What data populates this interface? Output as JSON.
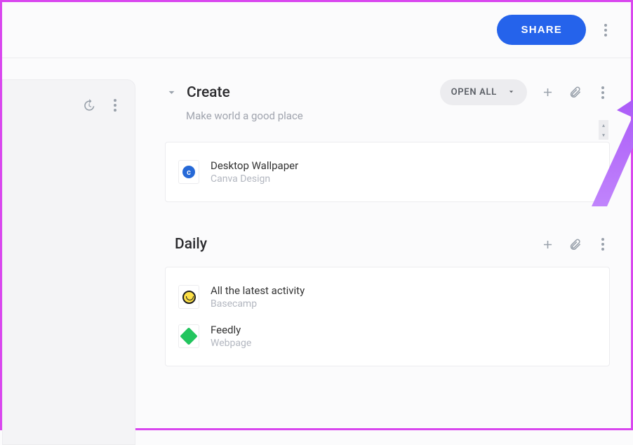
{
  "header": {
    "share_label": "SHARE"
  },
  "sections": [
    {
      "title": "Create",
      "subtitle": "Make world a good place",
      "open_all_label": "OPEN ALL",
      "has_open_all": true,
      "items": [
        {
          "title": "Desktop Wallpaper",
          "subtitle": "Canva Design",
          "icon": "canva"
        }
      ]
    },
    {
      "title": "Daily",
      "subtitle": "",
      "has_open_all": false,
      "items": [
        {
          "title": "All the latest activity",
          "subtitle": "Basecamp",
          "icon": "basecamp"
        },
        {
          "title": "Feedly",
          "subtitle": "Webpage",
          "icon": "feedly"
        }
      ]
    }
  ],
  "annotation": {
    "target": "add-button"
  }
}
